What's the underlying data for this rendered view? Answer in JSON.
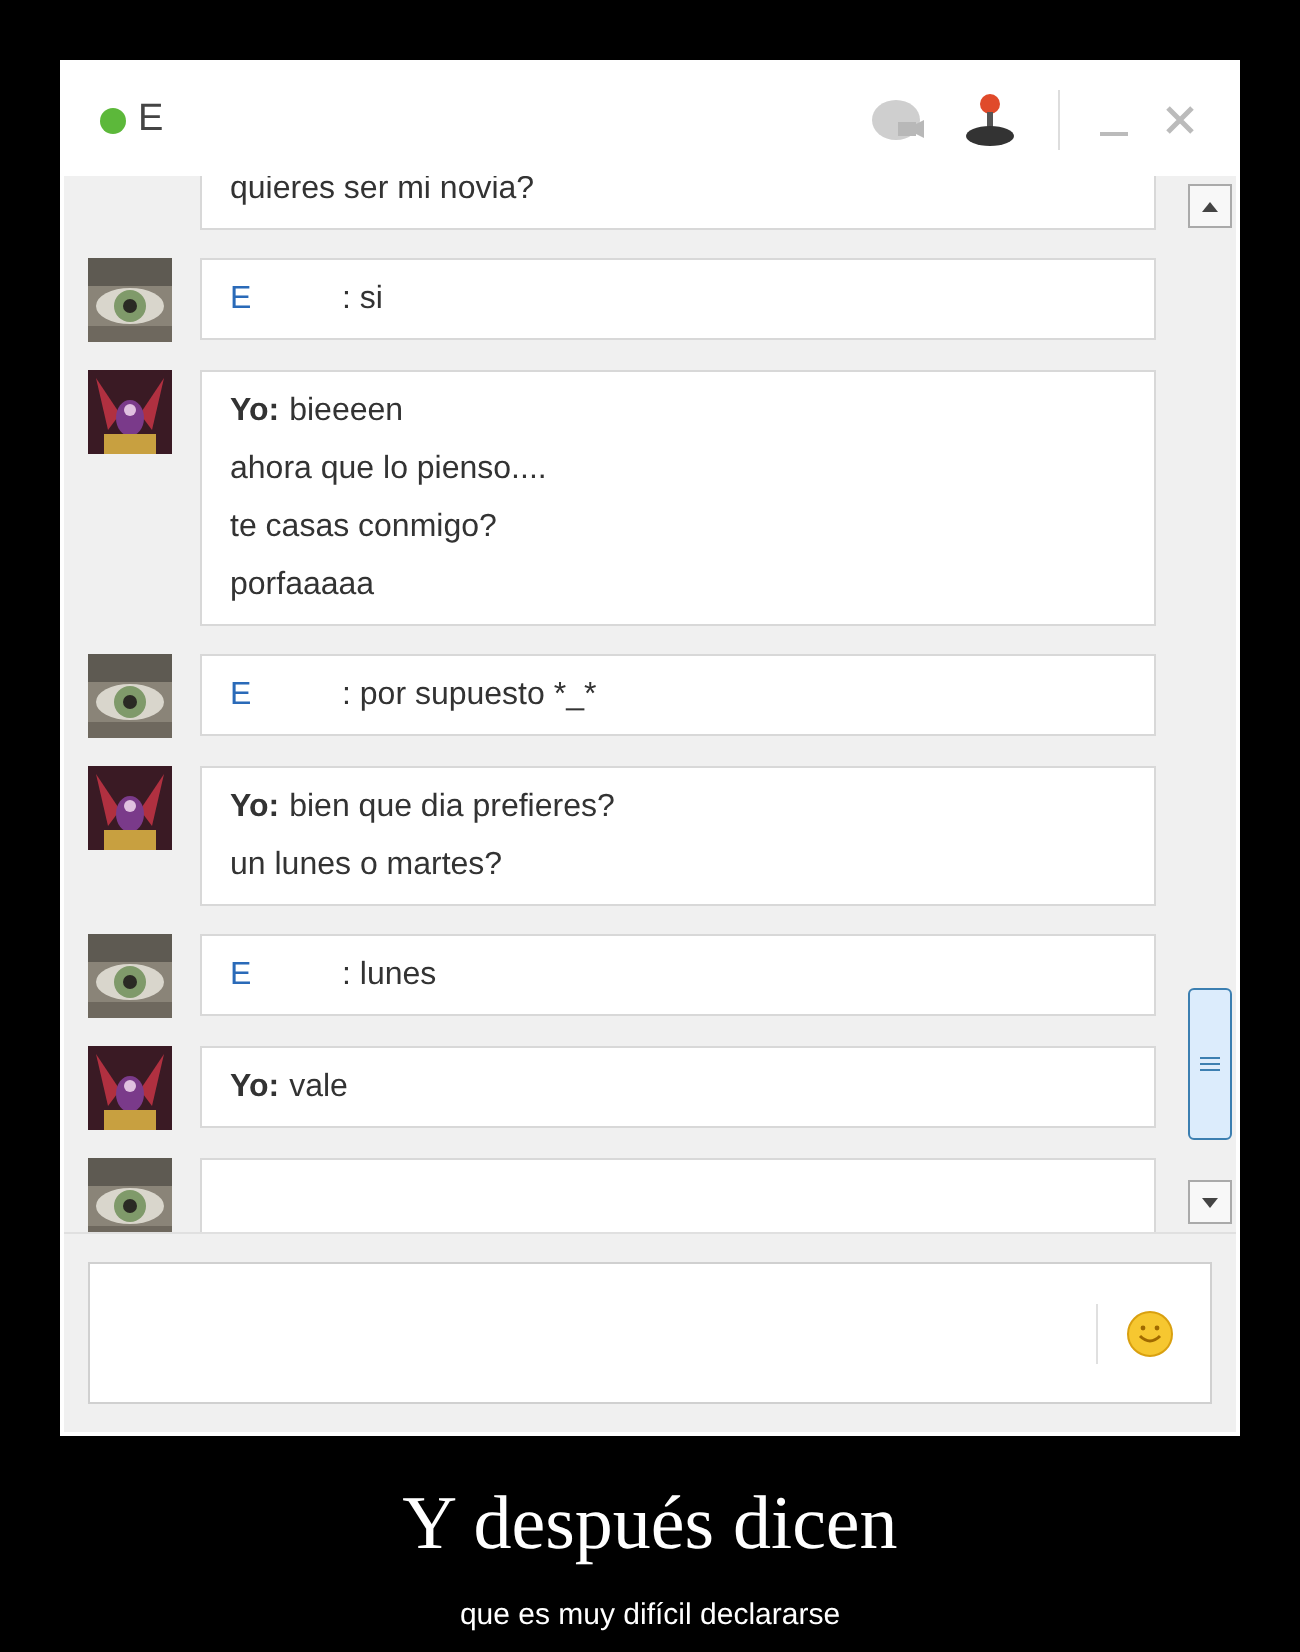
{
  "window": {
    "title": "E",
    "online": true
  },
  "messages": [
    {
      "kind": "continued",
      "lines": [
        "quieres ser mi novia?"
      ]
    },
    {
      "kind": "them",
      "sender": "E",
      "lines": [
        ": si"
      ]
    },
    {
      "kind": "me",
      "sender": "Yo:",
      "lines": [
        "bieeeen",
        "ahora que lo pienso....",
        "te casas conmigo?",
        "porfaaaaa"
      ]
    },
    {
      "kind": "them",
      "sender": "E",
      "lines": [
        ": por supuesto *_*"
      ]
    },
    {
      "kind": "me",
      "sender": "Yo:",
      "lines": [
        "bien que dia prefieres?",
        "un lunes o martes?"
      ]
    },
    {
      "kind": "them",
      "sender": "E",
      "lines": [
        ": lunes"
      ]
    },
    {
      "kind": "me",
      "sender": "Yo:",
      "lines": [
        "vale"
      ]
    },
    {
      "kind": "cut"
    }
  ],
  "caption": {
    "title": "Y después dicen",
    "subtitle": "que es muy difícil declararse"
  }
}
